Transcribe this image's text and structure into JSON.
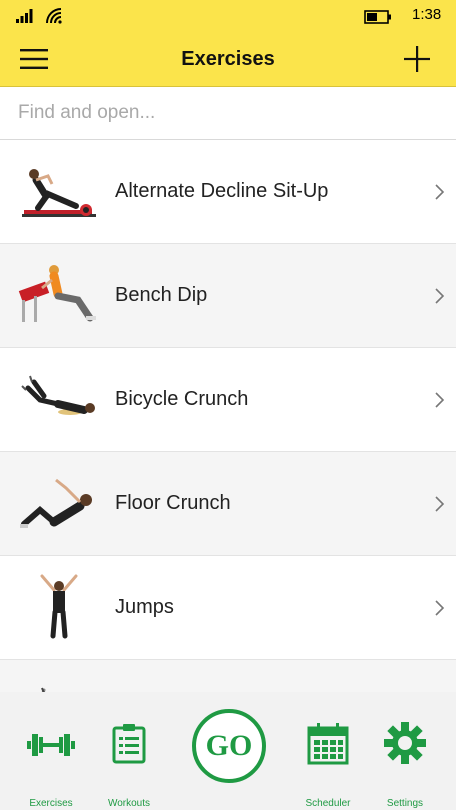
{
  "status": {
    "time": "1:38",
    "signal_icon": "signal-bars-icon",
    "wifi_icon": "wifi-icon",
    "battery_icon": "battery-icon"
  },
  "header": {
    "title": "Exercises",
    "menu_icon": "hamburger-menu-icon",
    "add_icon": "plus-icon"
  },
  "search": {
    "placeholder": "Find and open...",
    "value": ""
  },
  "exercises": [
    {
      "label": "Alternate Decline Sit-Up"
    },
    {
      "label": "Bench Dip"
    },
    {
      "label": "Bicycle Crunch"
    },
    {
      "label": "Floor Crunch"
    },
    {
      "label": "Jumps"
    }
  ],
  "tabs": {
    "exercises": {
      "label": "Exercises",
      "icon": "dumbbell-icon"
    },
    "workouts": {
      "label": "Workouts",
      "icon": "clipboard-icon"
    },
    "go": {
      "label": "GO",
      "icon": "go-button"
    },
    "scheduler": {
      "label": "Scheduler",
      "icon": "calendar-icon"
    },
    "settings": {
      "label": "Settings",
      "icon": "gear-icon"
    }
  },
  "colors": {
    "accent": "#fbe44b",
    "green": "#1f9a43"
  }
}
